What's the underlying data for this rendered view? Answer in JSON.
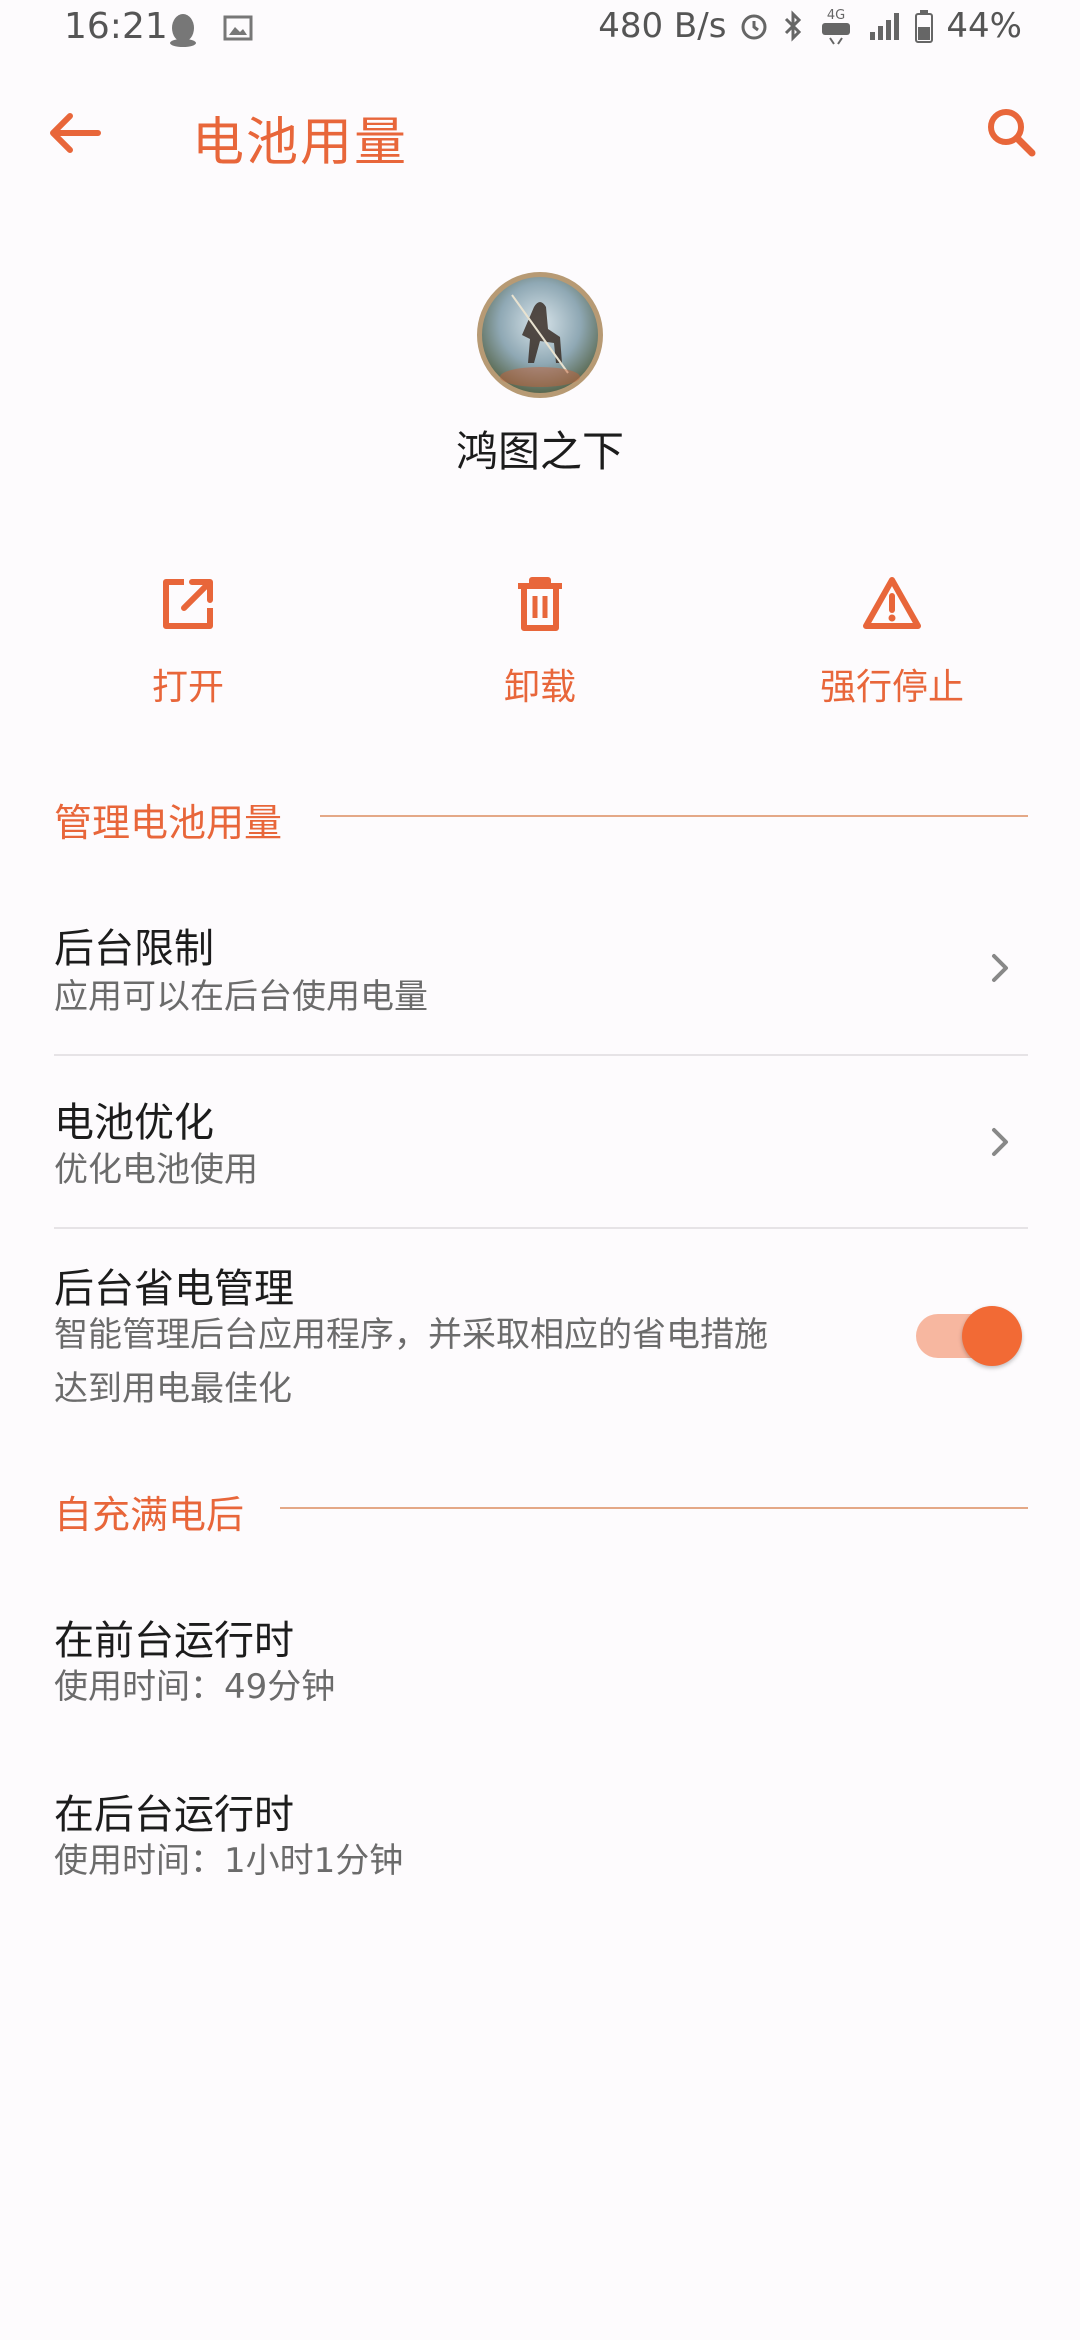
{
  "status_bar": {
    "time": "16:21",
    "net_speed": "480 B/s",
    "network_label": "4G",
    "battery": "44%",
    "left_icons": [
      "penguin-icon",
      "image-icon"
    ],
    "right_icons": [
      "alarm-icon",
      "bluetooth-icon",
      "hd-4g-icon",
      "signal-icon",
      "battery-icon"
    ]
  },
  "app_bar": {
    "title": "电池用量",
    "back_icon": "arrow-left-icon",
    "search_icon": "search-icon"
  },
  "app": {
    "name": "鸿图之下",
    "icon": "app-avatar-icon"
  },
  "actions": [
    {
      "label": "打开",
      "icon": "open-external-icon"
    },
    {
      "label": "卸载",
      "icon": "trash-icon"
    },
    {
      "label": "强行停止",
      "icon": "warning-icon"
    }
  ],
  "sections": {
    "manage": {
      "header": "管理电池用量",
      "items": [
        {
          "title": "后台限制",
          "subtitle": "应用可以在后台使用电量"
        },
        {
          "title": "电池优化",
          "subtitle": "优化电池使用"
        },
        {
          "title": "后台省电管理",
          "subtitle_line1": "智能管理后台应用程序，并采取相应的省电措施",
          "subtitle_line2": "达到用电最佳化",
          "toggle_on": true
        }
      ]
    },
    "since_full": {
      "header": "自充满电后",
      "items": [
        {
          "title": "在前台运行时",
          "subtitle": "使用时间：49分钟"
        },
        {
          "title": "在后台运行时",
          "subtitle": "使用时间：1小时1分钟"
        }
      ]
    }
  },
  "colors": {
    "accent": "#e8663a",
    "toggle_track": "#f7b7a0",
    "toggle_thumb": "#f26a35",
    "background": "#fdfbfd"
  }
}
